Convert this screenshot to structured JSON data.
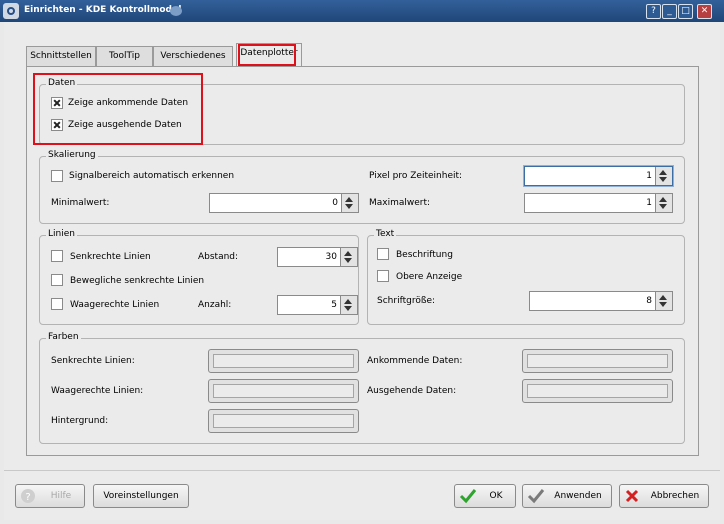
{
  "window": {
    "title": "Einrichten - KDE Kontrollmodul",
    "controls": {
      "help": "?",
      "minimize": "_",
      "maximize": "□",
      "close": "✕"
    }
  },
  "tabs": [
    {
      "label": "Schnittstellen"
    },
    {
      "label": "ToolTip"
    },
    {
      "label": "Verschiedenes"
    },
    {
      "label": "Datenplotter",
      "active": true
    }
  ],
  "daten": {
    "title": "Daten",
    "incoming": {
      "label": "Zeige ankommende Daten",
      "checked": true
    },
    "outgoing": {
      "label": "Zeige ausgehende Daten",
      "checked": true
    }
  },
  "skalierung": {
    "title": "Skalierung",
    "auto": {
      "label": "Signalbereich automatisch erkennen",
      "checked": false
    },
    "pixel": {
      "label": "Pixel pro Zeiteinheit:",
      "value": "1"
    },
    "min": {
      "label": "Minimalwert:",
      "value": "0"
    },
    "max": {
      "label": "Maximalwert:",
      "value": "1"
    }
  },
  "linien": {
    "title": "Linien",
    "vertical": {
      "label": "Senkrechte Linien",
      "checked": false
    },
    "moving": {
      "label": "Bewegliche senkrechte Linien",
      "checked": false
    },
    "horizontal": {
      "label": "Waagerechte Linien",
      "checked": false
    },
    "distance": {
      "label": "Abstand:",
      "value": "30"
    },
    "count": {
      "label": "Anzahl:",
      "value": "5"
    }
  },
  "text": {
    "title": "Text",
    "labels": {
      "label": "Beschriftung",
      "checked": false
    },
    "top": {
      "label": "Obere Anzeige",
      "checked": false
    },
    "fontsize": {
      "label": "Schriftgröße:",
      "value": "8"
    }
  },
  "farben": {
    "title": "Farben",
    "vertical": "Senkrechte Linien:",
    "horizontal": "Waagerechte Linien:",
    "background": "Hintergrund:",
    "incoming": "Ankommende Daten:",
    "outgoing": "Ausgehende Daten:"
  },
  "buttons": {
    "help": "Hilfe",
    "defaults": "Voreinstellungen",
    "ok": "OK",
    "apply": "Anwenden",
    "cancel": "Abbrechen"
  },
  "colors": {
    "highlight": "#e0101b",
    "title": "#1f4679"
  }
}
